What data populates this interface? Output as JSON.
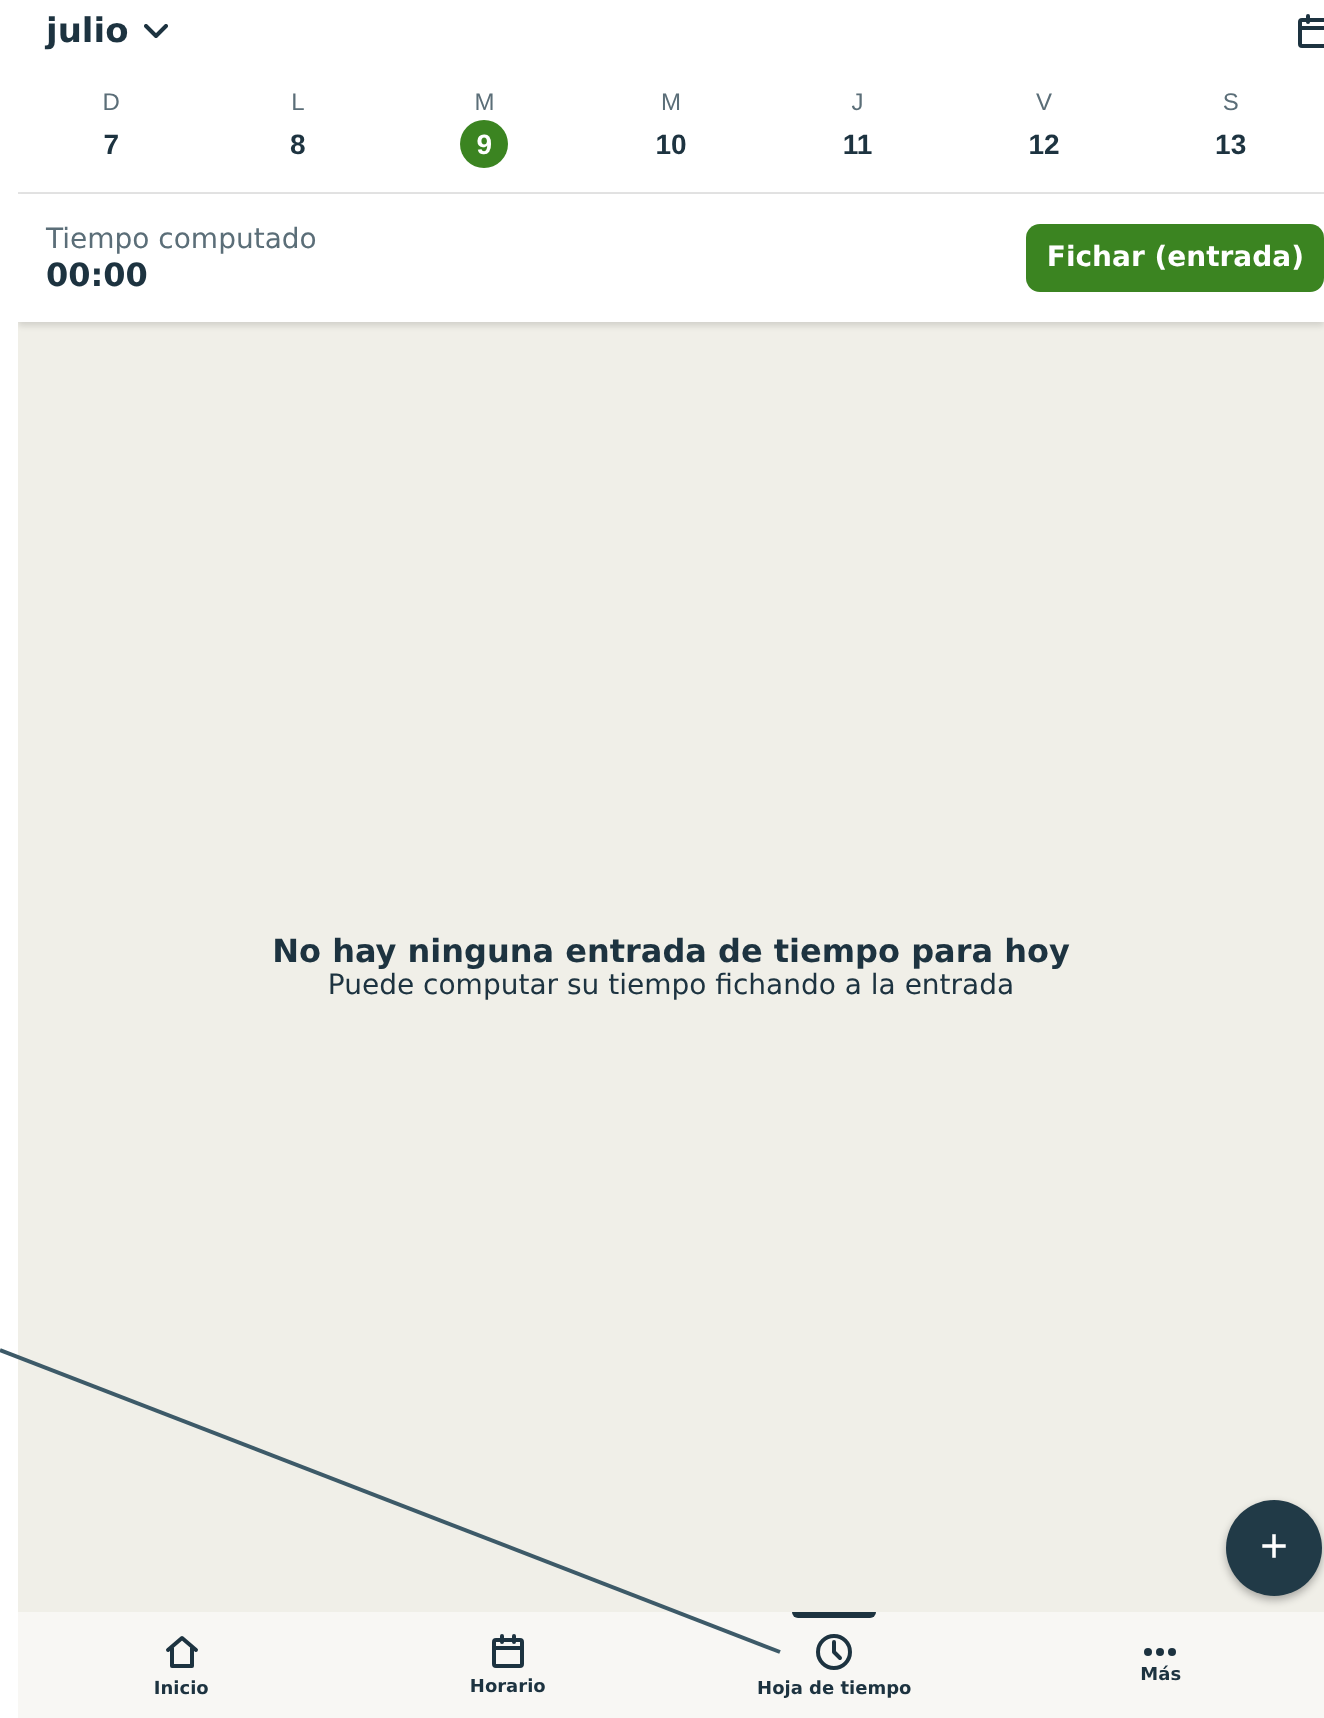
{
  "header": {
    "month": "julio"
  },
  "days": [
    {
      "letter": "D",
      "number": "7",
      "selected": false
    },
    {
      "letter": "L",
      "number": "8",
      "selected": false
    },
    {
      "letter": "M",
      "number": "9",
      "selected": true
    },
    {
      "letter": "M",
      "number": "10",
      "selected": false
    },
    {
      "letter": "J",
      "number": "11",
      "selected": false
    },
    {
      "letter": "V",
      "number": "12",
      "selected": false
    },
    {
      "letter": "S",
      "number": "13",
      "selected": false
    }
  ],
  "summary": {
    "label": "Tiempo computado",
    "value": "00:00",
    "button": "Fichar (entrada)"
  },
  "empty_state": {
    "title": "No hay ninguna entrada de tiempo para hoy",
    "subtitle": "Puede computar su tiempo fichando a la entrada"
  },
  "fab": {
    "symbol": "+"
  },
  "nav": [
    {
      "kind": "home",
      "label": "Inicio",
      "selected": false
    },
    {
      "kind": "calendar",
      "label": "Horario",
      "selected": false
    },
    {
      "kind": "clock",
      "label": "Hoja de tiempo",
      "selected": true
    },
    {
      "kind": "more",
      "label": "Más",
      "selected": false
    }
  ]
}
